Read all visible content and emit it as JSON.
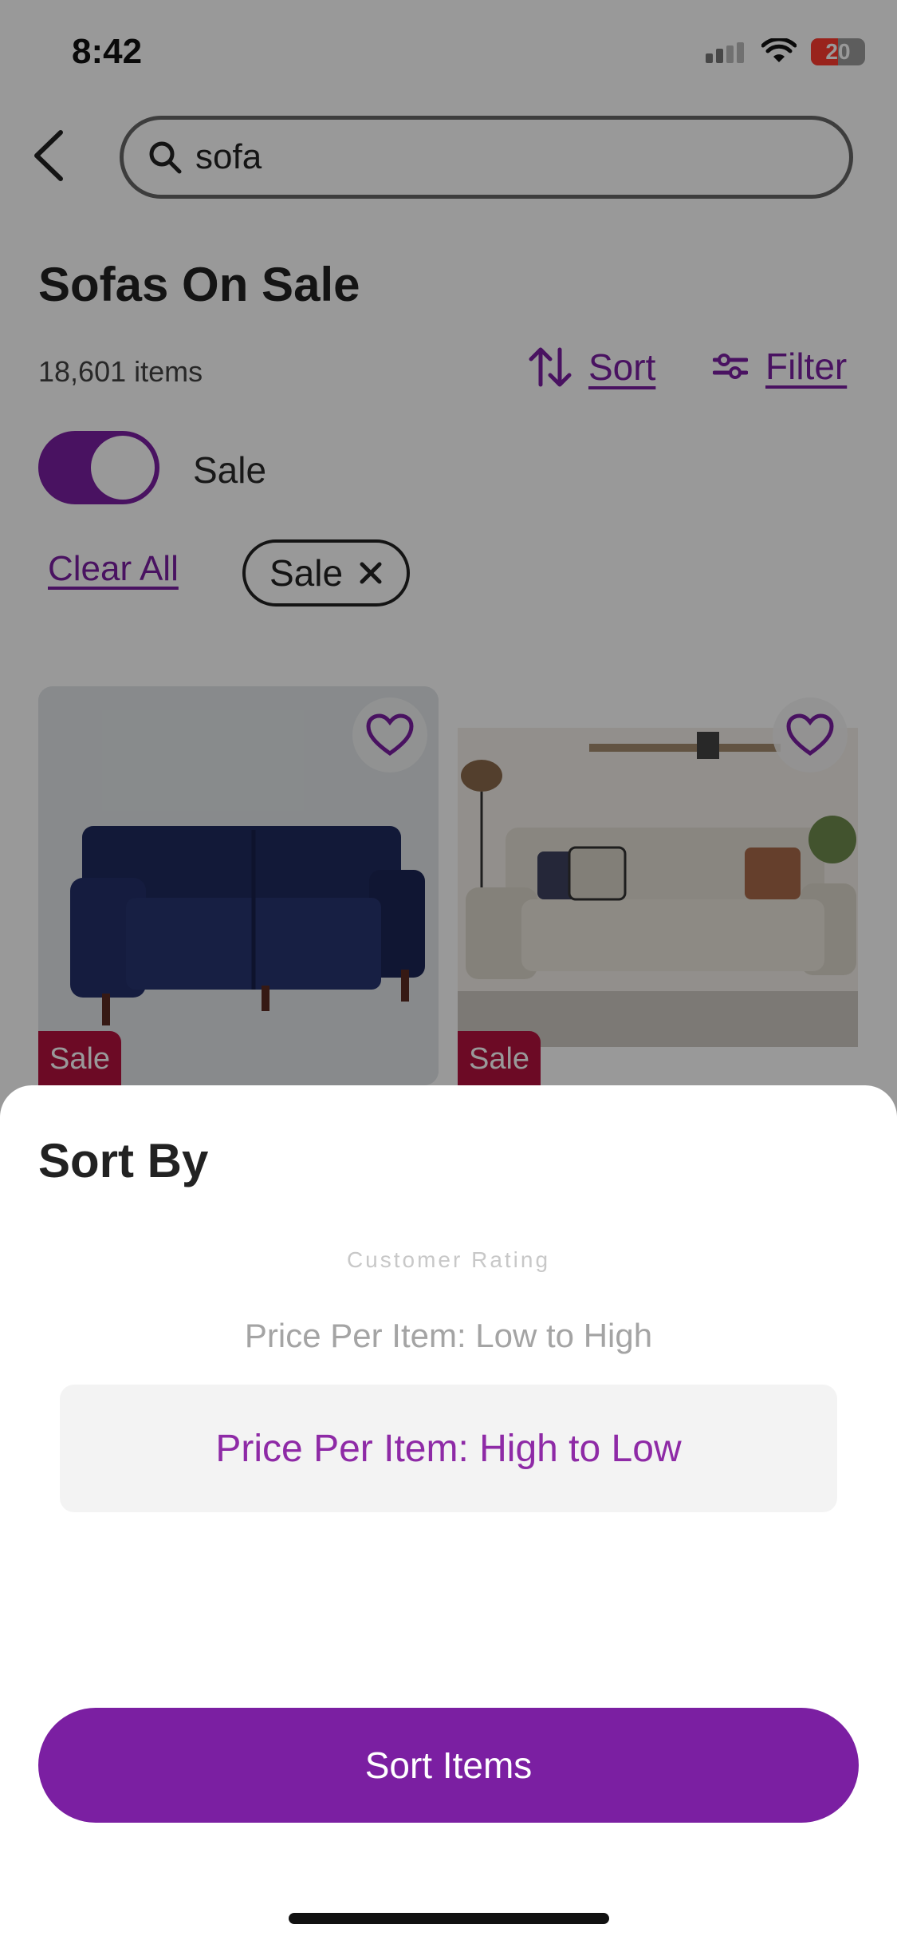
{
  "status_bar": {
    "time": "8:42",
    "battery_level": "20"
  },
  "search": {
    "query": "sofa"
  },
  "page": {
    "title": "Sofas On Sale",
    "items_count": "18,601 items",
    "sort_label": "Sort",
    "filter_label": "Filter"
  },
  "toggle": {
    "label": "Sale",
    "on": true
  },
  "filters": {
    "clear_all": "Clear All",
    "chips": [
      {
        "label": "Sale"
      }
    ]
  },
  "products": [
    {
      "badge": "Sale",
      "color": "#1f2a5e"
    },
    {
      "badge": "Sale",
      "color": "#e6e1d7"
    }
  ],
  "sheet": {
    "title": "Sort By",
    "options": [
      {
        "label": "Customer Rating"
      },
      {
        "label": "Price Per Item: Low to High"
      },
      {
        "label": "Price Per Item: High to Low",
        "selected": true
      }
    ],
    "button_label": "Sort Items"
  },
  "colors": {
    "accent": "#7b1fa2",
    "sale_badge": "#b5123f"
  }
}
